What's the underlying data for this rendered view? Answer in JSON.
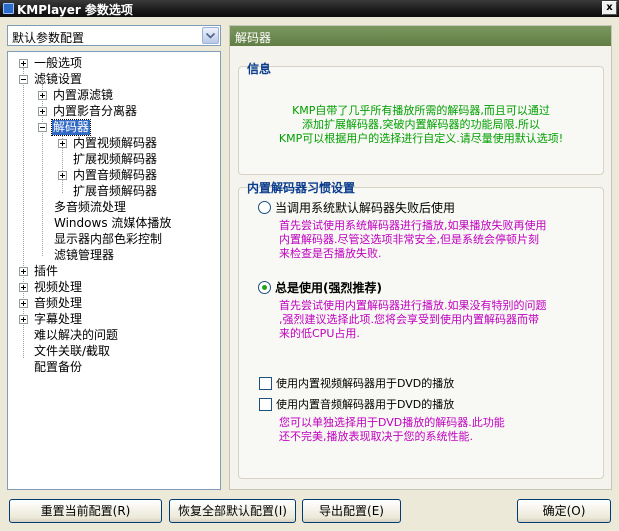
{
  "window": {
    "title": "KMPlayer 参数选项",
    "close_label": "x"
  },
  "config_select": {
    "value": "默认参数配置"
  },
  "tree": {
    "items": [
      {
        "label": "一般选项"
      },
      {
        "label": "滤镜设置"
      },
      {
        "label": "内置源滤镜"
      },
      {
        "label": "内置影音分离器"
      },
      {
        "label": "解码器"
      },
      {
        "label": "内置视频解码器"
      },
      {
        "label": "扩展视频解码器"
      },
      {
        "label": "内置音频解码器"
      },
      {
        "label": "扩展音频解码器"
      },
      {
        "label": "多音频流处理"
      },
      {
        "label": "Windows 流媒体播放"
      },
      {
        "label": "显示器内部色彩控制"
      },
      {
        "label": "滤镜管理器"
      },
      {
        "label": "插件"
      },
      {
        "label": "视频处理"
      },
      {
        "label": "音频处理"
      },
      {
        "label": "字幕处理"
      },
      {
        "label": "难以解决的问题"
      },
      {
        "label": "文件关联/截取"
      },
      {
        "label": "配置备份"
      }
    ]
  },
  "panel": {
    "header": "解码器",
    "info": {
      "title": "信息",
      "lines": [
        "KMP自带了几乎所有播放所需的解码器,而且可以通过",
        "添加扩展解码器,突破内置解码器的功能局限.所以",
        "KMP可以根据用户的选择进行自定义.请尽量使用默认选项!"
      ]
    },
    "habit": {
      "title": "内置解码器习惯设置",
      "option1": {
        "label": "当调用系统默认解码器失败后使用",
        "desc": [
          "首先尝试使用系统解码器进行播放,如果播放失败再使用",
          "内置解码器.尽管这选项非常安全,但是系统会停顿片刻",
          "来检查是否播放失败."
        ]
      },
      "option2": {
        "label": "总是使用(强烈推荐)",
        "desc": [
          "首先尝试使用内置解码器进行播放.如果没有特别的问题",
          ",强烈建议选择此项.您将会享受到使用内置解码器而带",
          "来的低CPU占用."
        ]
      },
      "check1": "使用内置视频解码器用于DVD的播放",
      "check2": "使用内置音频解码器用于DVD的播放",
      "dvd_note": [
        "您可以单独选择用于DVD播放的解码器.此功能",
        "还不完美,播放表现取决于您的系统性能."
      ]
    }
  },
  "buttons": {
    "reset_current": "重置当前配置(R)",
    "restore_all": "恢复全部默认配置(I)",
    "export": "导出配置(E)",
    "ok": "确定(O)"
  },
  "colors": {
    "accent_header": "#6b8a50",
    "info_text": "#00a000",
    "desc_text": "#c000c0",
    "group_title": "#0b3d8f"
  }
}
